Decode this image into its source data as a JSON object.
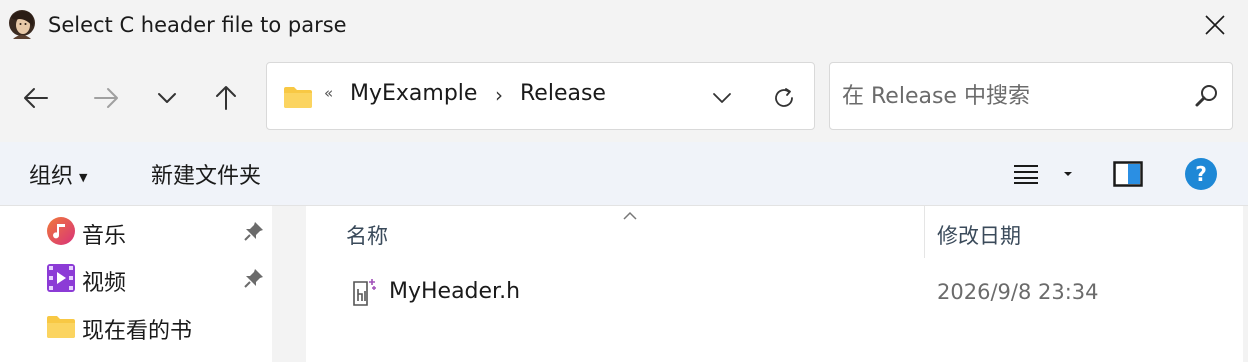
{
  "window": {
    "title": "Select C header file to parse",
    "app_icon": "portrait-avatar-icon",
    "close_icon": "close-icon"
  },
  "nav": {
    "back_icon": "arrow-left-icon",
    "forward_icon": "arrow-right-icon",
    "recent_icon": "chevron-down-icon",
    "up_icon": "arrow-up-icon"
  },
  "address": {
    "overflow_marker": "«",
    "breadcrumbs": [
      "MyExample",
      "Release"
    ],
    "separator": "›",
    "dropdown_icon": "chevron-down-icon",
    "refresh_icon": "refresh-icon"
  },
  "search": {
    "placeholder": "在 Release 中搜索",
    "value": "",
    "icon": "search-icon"
  },
  "command_bar": {
    "organize_label": "组织",
    "new_folder_label": "新建文件夹",
    "view_icon": "list-view-icon",
    "preview_pane_icon": "preview-pane-icon",
    "help_label": "?"
  },
  "sidebar": {
    "items": [
      {
        "label": "音乐",
        "icon": "music-icon",
        "pinned": true
      },
      {
        "label": "视频",
        "icon": "video-icon",
        "pinned": true
      },
      {
        "label": "现在看的书",
        "icon": "folder-icon",
        "pinned": false
      }
    ]
  },
  "file_list": {
    "columns": [
      "名称",
      "修改日期"
    ],
    "sort_column": "名称",
    "rows": [
      {
        "name": "MyHeader.h",
        "modified": "2026/9/8 23:34",
        "icon": "c-header-file-icon"
      }
    ]
  },
  "colors": {
    "accent": "#0067c0",
    "folder_yellow": "#f8c844",
    "help_blue": "#1e88d6",
    "music_pink": "#e0457b",
    "video_purple": "#8c3bd6"
  }
}
